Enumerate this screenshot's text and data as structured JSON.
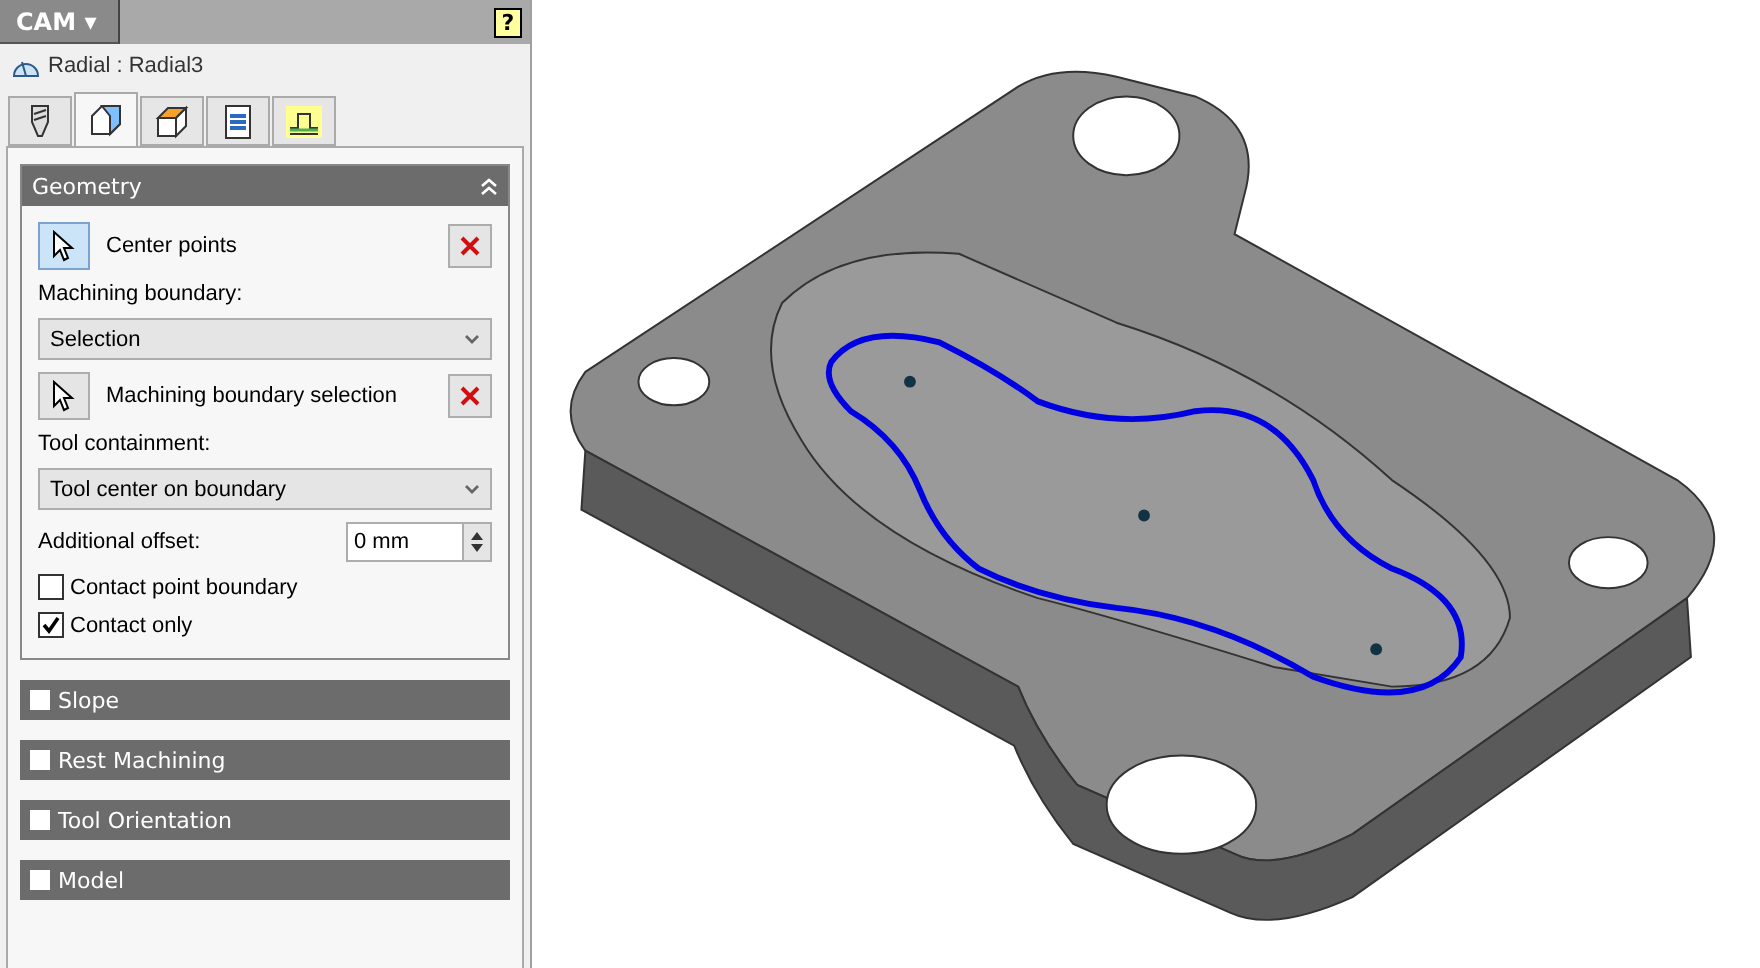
{
  "header": {
    "menu": "CAM ▾",
    "help": "?"
  },
  "operation": "Radial : Radial3",
  "tabs": [
    {
      "kind": "tool",
      "selected": false
    },
    {
      "kind": "geometry",
      "selected": true
    },
    {
      "kind": "heights",
      "selected": false
    },
    {
      "kind": "passes",
      "selected": false
    },
    {
      "kind": "linking",
      "selected": false
    }
  ],
  "geometry": {
    "title": "Geometry",
    "expanded": true,
    "center_points": {
      "label": "Center points",
      "active": true
    },
    "boundary_label": "Machining boundary:",
    "boundary_value": "Selection",
    "boundary_selection": {
      "label": "Machining boundary selection",
      "active": false
    },
    "containment_label": "Tool containment:",
    "containment_value": "Tool center on boundary",
    "offset_label": "Additional offset:",
    "offset_value": "0 mm",
    "options": [
      {
        "label": "Contact point boundary",
        "checked": false
      },
      {
        "label": "Contact only",
        "checked": true
      }
    ]
  },
  "sections": [
    {
      "title": "Slope",
      "checked": false
    },
    {
      "title": "Rest Machining",
      "checked": false
    },
    {
      "title": "Tool Orientation",
      "checked": false
    },
    {
      "title": "Model",
      "checked": false
    }
  ]
}
